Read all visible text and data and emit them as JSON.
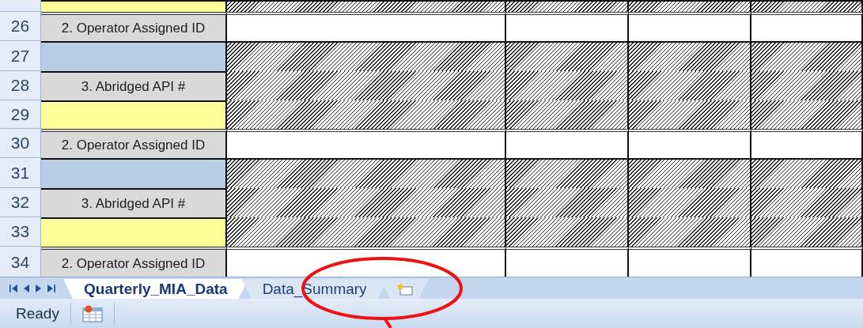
{
  "rows": [
    {
      "color": "#ffff99",
      "hatched": true,
      "group_start": false
    },
    {
      "number": "26",
      "color": "#d9d9d9",
      "label": "2. Operator Assigned ID",
      "hatched": false,
      "group_start": true
    },
    {
      "number": "27",
      "color": "#b8cce4",
      "hatched": true,
      "group_start": false
    },
    {
      "number": "28",
      "color": "#d9d9d9",
      "label": "3. Abridged API #",
      "hatched": true,
      "group_start": false
    },
    {
      "number": "29",
      "color": "#ffff99",
      "hatched": true,
      "group_start": false
    },
    {
      "number": "30",
      "color": "#d9d9d9",
      "label": "2. Operator Assigned ID",
      "hatched": false,
      "group_start": true
    },
    {
      "number": "31",
      "color": "#b8cce4",
      "hatched": true,
      "group_start": false
    },
    {
      "number": "32",
      "color": "#d9d9d9",
      "label": "3. Abridged API #",
      "hatched": true,
      "group_start": false
    },
    {
      "number": "33",
      "color": "#ffff99",
      "hatched": true,
      "group_start": false
    },
    {
      "number": "34",
      "color": "#d9d9d9",
      "label": "2. Operator Assigned ID",
      "hatched": false,
      "group_start": true
    }
  ],
  "sheet_tabs": [
    {
      "label": "Quarterly_MIA_Data",
      "selected": true
    },
    {
      "label": "Data_Summary",
      "selected": false
    }
  ],
  "status_bar": {
    "text": "Ready"
  },
  "annotation": {
    "kind": "ellipse"
  }
}
